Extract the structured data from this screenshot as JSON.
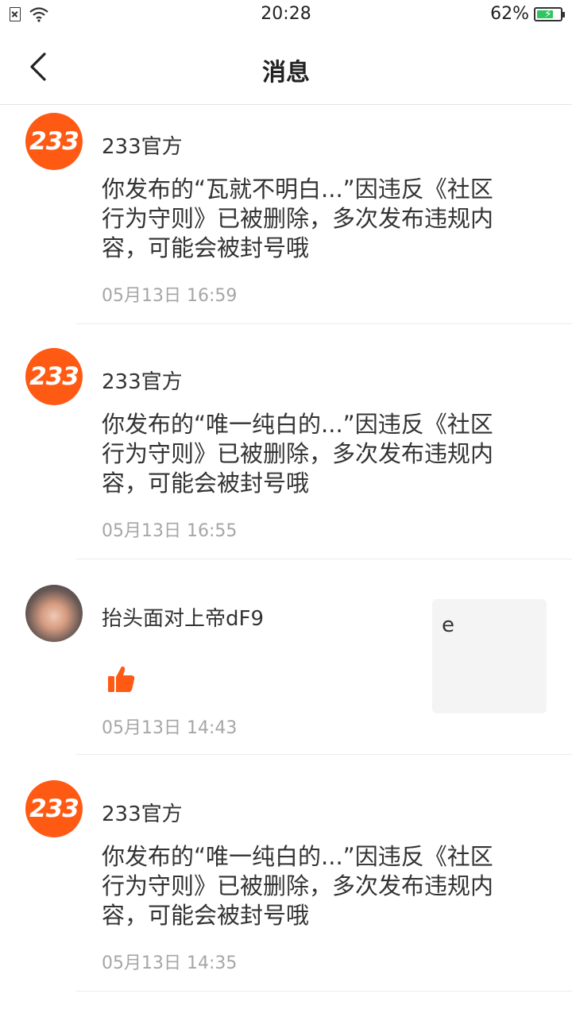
{
  "status_bar": {
    "time": "20:28",
    "battery": "62%",
    "battery_level": 0.62,
    "icons": [
      "sim-icon",
      "wifi-icon",
      "battery-icon"
    ]
  },
  "header": {
    "title": "消息",
    "back_icon": "chevron-left-icon"
  },
  "messages": [
    {
      "name": "233官方",
      "avatar_text": "233",
      "content": "你发布的“瓦就不明白...”因违反《社区行为守则》已被删除，多次发布违规内容，可能会被封号哦",
      "time": "05月13日 16:59"
    },
    {
      "name": "233官方",
      "avatar_text": "233",
      "content": "你发布的“唯一纯白的...”因违反《社区行为守则》已被删除，多次发布违规内容，可能会被封号哦",
      "time": "05月13日 16:55"
    },
    {
      "name": "抬头面对上帝dF9",
      "icon": "thumbs-up-icon",
      "preview": "e",
      "time": "05月13日 14:43"
    },
    {
      "name": "233官方",
      "avatar_text": "233",
      "content": "你发布的“唯一纯白的...”因违反《社区行为守则》已被删除，多次发布违规内容，可能会被封号哦",
      "time": "05月13日 14:35"
    }
  ],
  "colors": {
    "accent": "#ff5a14",
    "battery_fill": "#2ec75f"
  }
}
